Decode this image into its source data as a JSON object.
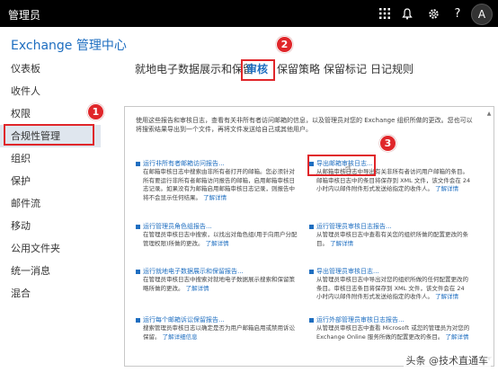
{
  "topbar": {
    "title": "管理员",
    "avatar_letter": "A",
    "icons": [
      "app-launcher-icon",
      "bell-icon",
      "gear-icon",
      "help-icon"
    ]
  },
  "app_title": "Exchange 管理中心",
  "sidebar": {
    "items": [
      {
        "label": "仪表板"
      },
      {
        "label": "收件人"
      },
      {
        "label": "权限"
      },
      {
        "label": "合规性管理"
      },
      {
        "label": "组织"
      },
      {
        "label": "保护"
      },
      {
        "label": "邮件流"
      },
      {
        "label": "移动"
      },
      {
        "label": "公用文件夹"
      },
      {
        "label": "统一消息"
      },
      {
        "label": "混合"
      }
    ],
    "active_index": 3
  },
  "tabs": [
    {
      "label": "就地电子数据展示和保留"
    },
    {
      "label": "审核"
    },
    {
      "label": "保留策略"
    },
    {
      "label": "保留标记"
    },
    {
      "label": "日记规则"
    }
  ],
  "active_tab": "审核",
  "step_badges": [
    "1",
    "2",
    "3"
  ],
  "intro": "使用这些报告和审核日志，查看有关非所有者访问邮箱的信息，以及管理员对您的 Exchange 组织所做的更改。您也可以将搜索结果导出到一个文件，再将文件发送给自己或其他用户。",
  "reports": [
    {
      "title": "运行非所有者邮箱访问报告...",
      "desc": "在邮箱审核日志中搜索由非所有者打开的邮箱。您必须针对所有要运行非所有者邮箱访问报告的邮箱，启用邮箱审核日志记录。如果没有为邮箱启用邮箱审核日志记录，则报告中将不会显示任何结果。",
      "more": "了解详情"
    },
    {
      "title": "导出邮箱审核日志...",
      "desc": "从邮箱审核日志中导出有关非所有者访问用户邮箱的条目。邮箱审核日志中的条目将保存到 XML 文件，该文件会在 24 小时内以邮件附件形式发送给指定的收件人。",
      "more": "了解详情"
    },
    {
      "title": "运行管理员角色组报告...",
      "desc": "在管理员审核日志中搜索，以找出对角色组(用于向用户分配管理权限)所做的更改。",
      "more": "了解详情"
    },
    {
      "title": "运行管理员审核日志报告...",
      "desc": "从管理员审核日志中查看有关您的组织所做的配置更改的条目。",
      "more": "了解详情"
    },
    {
      "title": "运行就地电子数据展示和保留报告...",
      "desc": "在管理员审核日志中搜索对就地电子数据展示搜索和保留策略所做的更改。",
      "more": "了解详情"
    },
    {
      "title": "导出管理员审核日志...",
      "desc": "从管理员审核日志中导出对您的组织所做的任何配置更改的条目。审核日志条目将保存到 XML 文件，该文件会在 24 小时内以邮件附件形式发送给指定的收件人。",
      "more": "了解详情"
    },
    {
      "title": "运行每个邮箱诉讼保留报告...",
      "desc": "搜索管理员审核日志以确定是否为用户邮箱启用或禁用诉讼保留。",
      "more": "了解详细信息"
    },
    {
      "title": "运行外部管理员审核日志报告...",
      "desc": "从管理员审核日志中查看 Microsoft 或您的管理员为对您的 Exchange Online 服务所做的配置更改的条目。",
      "more": "了解详情"
    }
  ],
  "watermark": "头条 @技术直通车"
}
